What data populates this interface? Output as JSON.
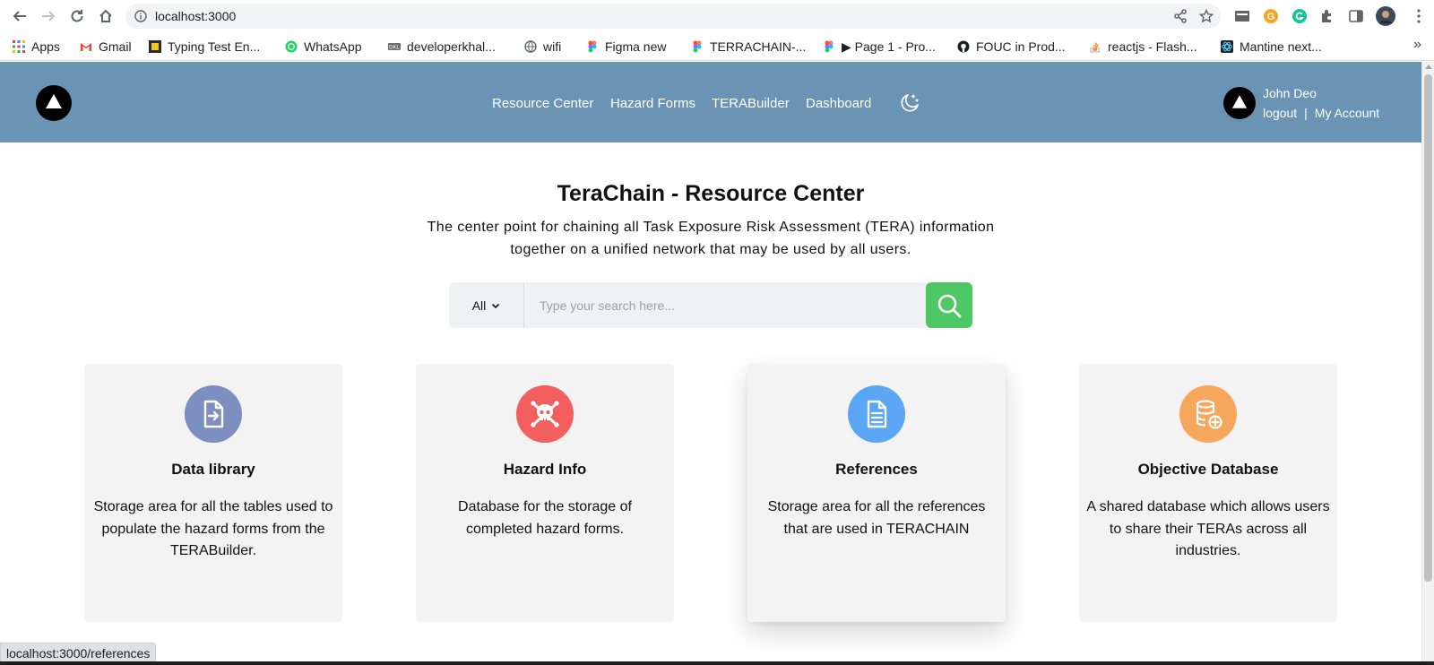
{
  "browser": {
    "url": "localhost:3000",
    "bookmarks": [
      {
        "label": "Apps",
        "icon": "apps-grid-icon"
      },
      {
        "label": "Gmail",
        "icon": "gmail-icon"
      },
      {
        "label": "Typing Test En...",
        "icon": "typing-test-icon"
      },
      {
        "label": "WhatsApp",
        "icon": "whatsapp-icon"
      },
      {
        "label": "developerkhal...",
        "icon": "developer-icon"
      },
      {
        "label": "wifi",
        "icon": "globe-icon"
      },
      {
        "label": "Figma new",
        "icon": "figma-icon"
      },
      {
        "label": "TERRACHAIN-...",
        "icon": "figma-icon"
      },
      {
        "label": "▶ Page 1 - Pro...",
        "icon": "figma-icon"
      },
      {
        "label": "FOUC in Prod...",
        "icon": "github-icon"
      },
      {
        "label": "reactjs - Flash...",
        "icon": "stackoverflow-icon"
      },
      {
        "label": "Mantine next...",
        "icon": "react-icon"
      }
    ],
    "more_bookmarks": "»",
    "status_url": "localhost:3000/references"
  },
  "header": {
    "nav": [
      {
        "label": "Resource Center"
      },
      {
        "label": "Hazard Forms"
      },
      {
        "label": "TERABuilder"
      },
      {
        "label": "Dashboard"
      }
    ],
    "theme_toggle_icon": "moon-stars-icon",
    "user": {
      "name": "John Deo",
      "logout": "logout",
      "separator": "|",
      "account": "My Account"
    }
  },
  "hero": {
    "title": "TeraChain - Resource Center",
    "subtitle_line1": "The center point for chaining all Task Exposure Risk Assessment (TERA) information",
    "subtitle_line2": "together on a unified network that may be used by all users."
  },
  "search": {
    "filter_value": "All",
    "placeholder": "Type your search here..."
  },
  "cards": [
    {
      "title": "Data library",
      "description": "Storage area for all the tables used to populate the hazard forms from the TERABuilder.",
      "icon": "file-import-icon",
      "color": "#7d8ec0"
    },
    {
      "title": "Hazard Info",
      "description": "Database for the storage of completed hazard forms.",
      "icon": "skull-crossbones-icon",
      "color": "#f35f5e"
    },
    {
      "title": "References",
      "description": "Storage area for all the references that are used in TERACHAIN",
      "icon": "document-icon",
      "color": "#5ba6f5"
    },
    {
      "title": "Objective Database",
      "description": "A shared database which allows users to share their TERAs across all industries.",
      "icon": "database-plus-icon",
      "color": "#f7a75b"
    }
  ],
  "colors": {
    "header_bg": "#6b93b4",
    "search_button": "#4ec865",
    "card_bg": "#f3f3f4"
  }
}
